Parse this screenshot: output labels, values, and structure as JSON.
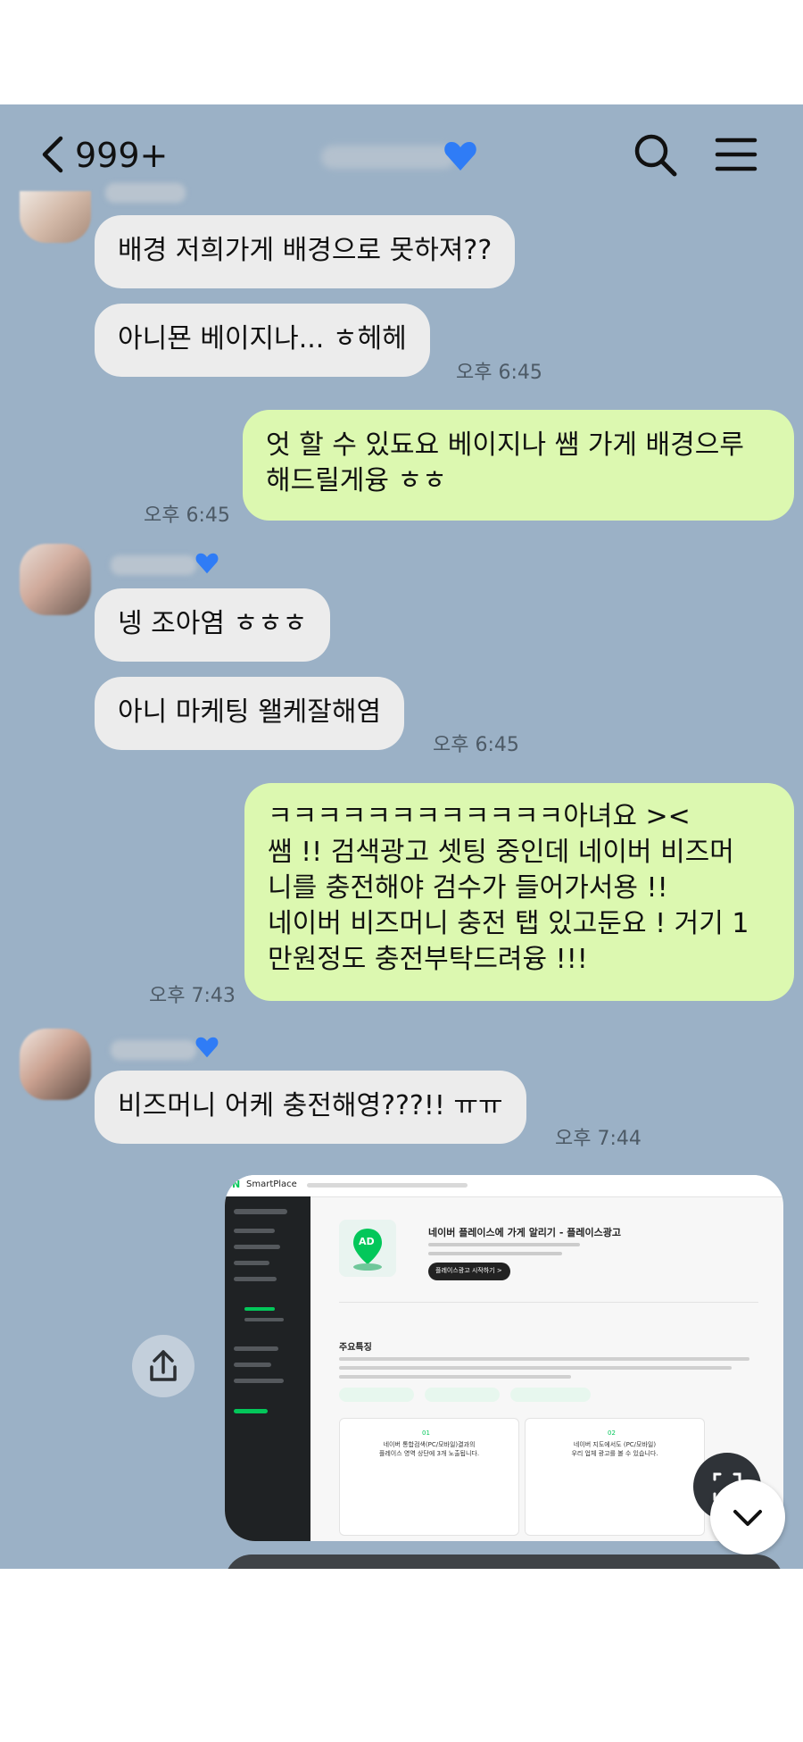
{
  "header": {
    "back_count": "999+"
  },
  "messages": [
    {
      "id": 1,
      "text": "배경 저희가게 배경으로 못하져??"
    },
    {
      "id": 2,
      "text": "아니묜 베이지나... ㅎ헤헤",
      "time": "오후 6:45"
    },
    {
      "id": 3,
      "text": "엇 할 수 있됴요 베이지나 쌤 가게 배경으루\n해드릴게융 ㅎㅎ",
      "time": "오후 6:45"
    },
    {
      "id": 4,
      "text": "넹 조아염 ㅎㅎㅎ"
    },
    {
      "id": 5,
      "text": "아니 마케팅 왤케잘해염",
      "time": "오후 6:45"
    },
    {
      "id": 6,
      "text": "ㅋㅋㅋㅋㅋㅋㅋㅋㅋㅋㅋㅋ아녀요 ><\n쌤 !! 검색광고 셋팅 중인데 네이버 비즈머\n니를 충전해야 검수가 들어가서용 !!\n네이버 비즈머니 충전 탭 있고둔요 ! 거기 1\n만원정도 충전부탁드려융 !!!",
      "time": "오후 7:43"
    },
    {
      "id": 7,
      "text": "비즈머니 어케 충전해영???!! ㅠㅠ",
      "time": "오후 7:44"
    }
  ],
  "screenshot": {
    "logo_n": "N",
    "logo_text": "SmartPlace",
    "title": "네이버 플레이스에 가게 알리기 - 플레이스광고",
    "cta": "플레이스광고 시작하기 >",
    "section": "주요특징",
    "ad_badge": "AD",
    "card1_num": "01",
    "card1_text": "네이버 통합검색(PC/모바일)결과의\n플레이스 영역 상단에 3개 노출됩니다.",
    "card2_num": "02",
    "card2_text": "네이버 지도에서도 (PC/모바일)\n우리 업체 광고를 볼 수 있습니다."
  },
  "colors": {
    "chat_bg": "#9bb1c6",
    "incoming": "#ececec",
    "outgoing": "#dcf8b0",
    "name_heart": "#2f7cf6"
  }
}
